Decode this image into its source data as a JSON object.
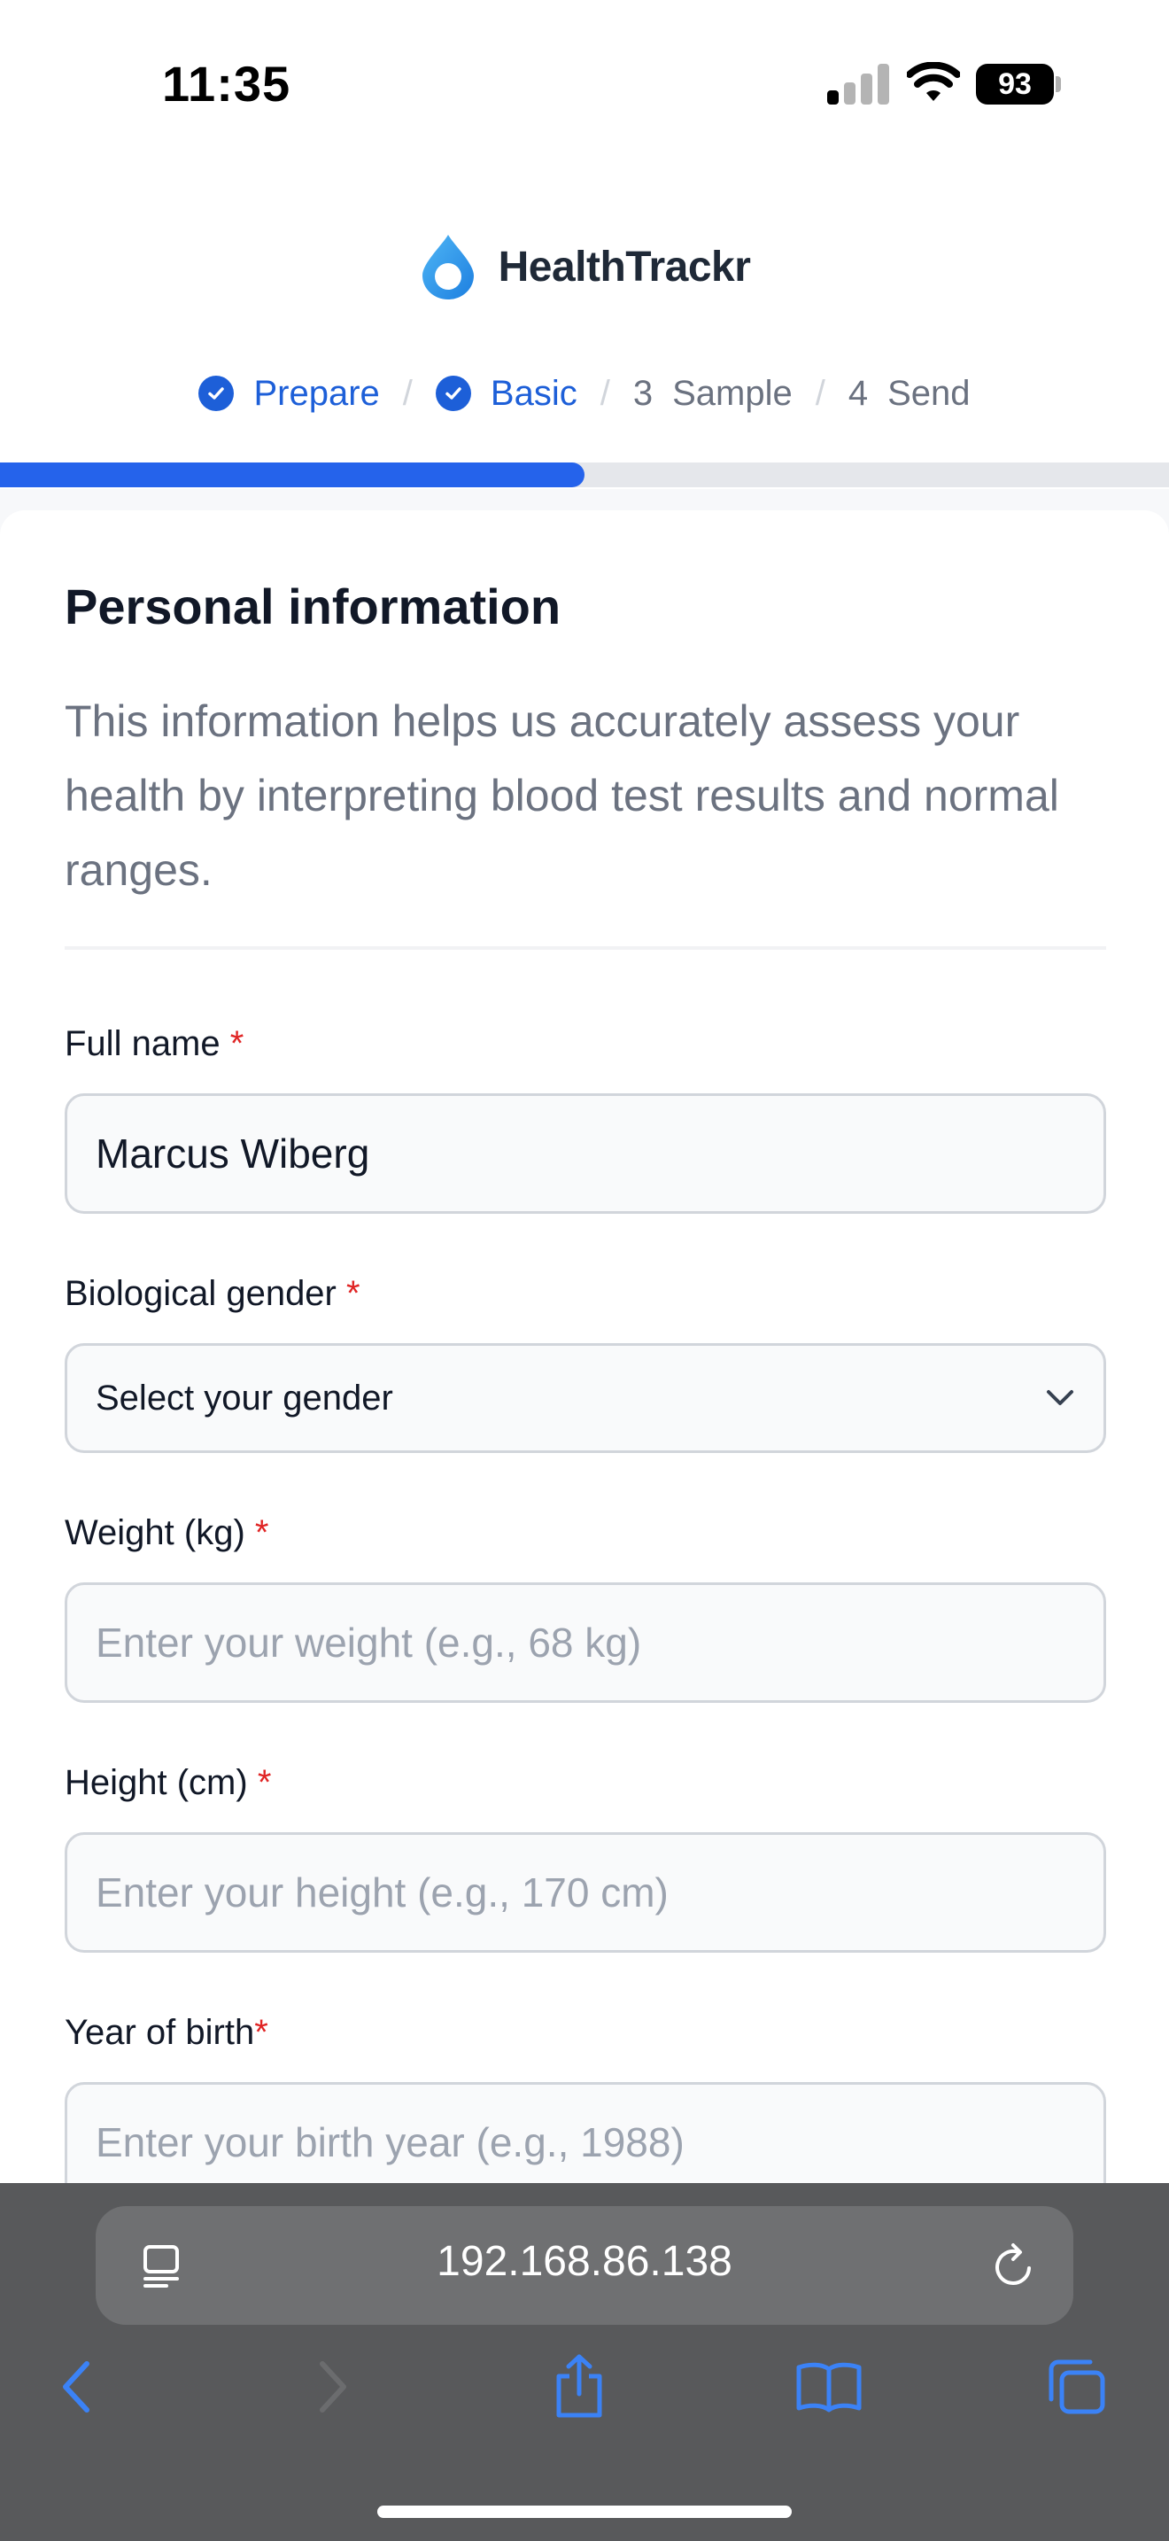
{
  "status_bar": {
    "time": "11:35",
    "battery": "93"
  },
  "brand": {
    "name": "HealthTrackr"
  },
  "stepper": {
    "steps": [
      {
        "label": "Prepare",
        "state": "done"
      },
      {
        "label": "Basic",
        "state": "done"
      },
      {
        "number": "3",
        "label": "Sample",
        "state": "todo"
      },
      {
        "number": "4",
        "label": "Send",
        "state": "todo"
      }
    ],
    "separator": "/"
  },
  "progress": {
    "fraction": 0.5
  },
  "form": {
    "title": "Personal information",
    "description": "This information helps us accurately assess your health by interpreting blood test results and normal ranges.",
    "required_marker": "*",
    "full_name": {
      "label": "Full name",
      "value": "Marcus Wiberg"
    },
    "gender": {
      "label": "Biological gender",
      "selected": "Select your gender"
    },
    "weight": {
      "label": "Weight (kg)",
      "placeholder": "Enter your weight (e.g., 68 kg)"
    },
    "height": {
      "label": "Height (cm)",
      "placeholder": "Enter your height (e.g., 170 cm)"
    },
    "birth_year": {
      "label": "Year of birth",
      "placeholder": "Enter your birth year (e.g., 1988)"
    }
  },
  "browser": {
    "url": "192.168.86.138",
    "icons": [
      "reader-icon",
      "reload-icon",
      "back-icon",
      "forward-icon",
      "share-icon",
      "bookmarks-icon",
      "tabs-icon"
    ]
  },
  "colors": {
    "accent": "#2563eb",
    "step_done": "#1d5fd8",
    "required": "#e02424",
    "chrome": "#58595b"
  }
}
